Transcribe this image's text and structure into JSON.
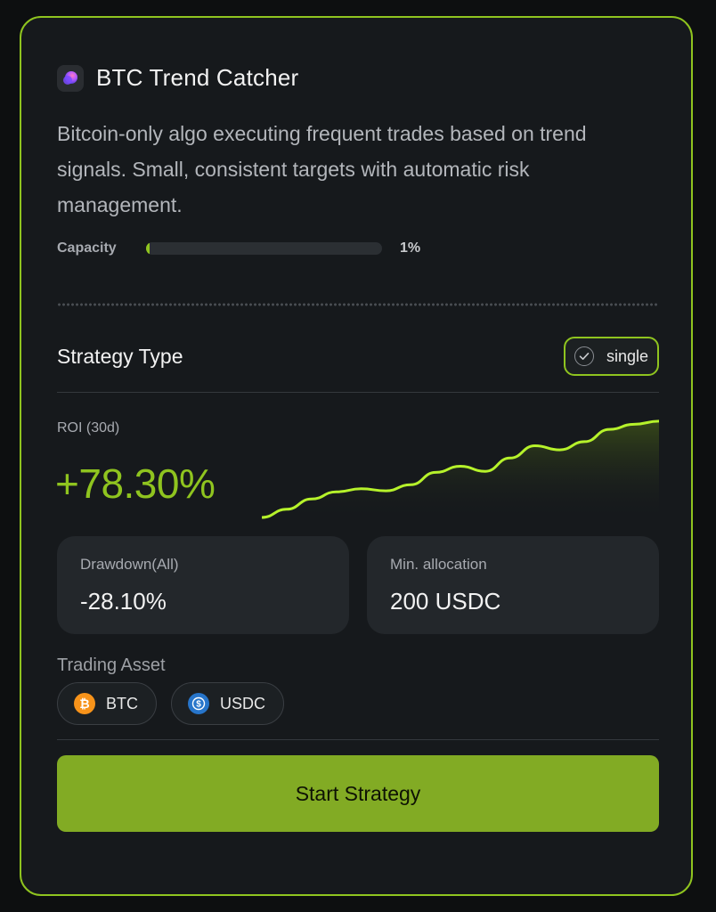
{
  "strategy": {
    "title": "BTC Trend Catcher",
    "logo_icon": "gradient-orb-icon",
    "description": "Bitcoin-only algo executing frequent trades based on trend signals. Small, consistent targets with automatic risk management.",
    "capacity_label": "Capacity",
    "capacity_percent": 1,
    "capacity_text": "1%"
  },
  "strategy_type": {
    "label": "Strategy Type",
    "badge_label": "single",
    "badge_icon": "check-circle-icon"
  },
  "roi": {
    "label": "ROI (30d)",
    "value": "+78.30%"
  },
  "stats": {
    "drawdown_label": "Drawdown(All)",
    "drawdown_value": "-28.10%",
    "min_alloc_label": "Min. allocation",
    "min_alloc_value": "200 USDC"
  },
  "assets": {
    "label": "Trading Asset",
    "items": [
      {
        "name": "BTC",
        "icon": "bitcoin-icon",
        "color": "#f7931a"
      },
      {
        "name": "USDC",
        "icon": "usdc-icon",
        "color": "#2775ca"
      }
    ]
  },
  "actions": {
    "start_label": "Start Strategy"
  },
  "colors": {
    "accent": "#8fc41f",
    "button": "#82ab24",
    "card_bg": "#16191c"
  },
  "chart_data": {
    "type": "area",
    "x": [
      0,
      1,
      2,
      3,
      4,
      5,
      6,
      7,
      8,
      9,
      10,
      11,
      12,
      13,
      14,
      15,
      16
    ],
    "values": [
      0,
      8,
      18,
      25,
      28,
      26,
      32,
      44,
      50,
      45,
      58,
      70,
      66,
      74,
      86,
      91,
      94
    ],
    "ylim": [
      0,
      100
    ],
    "title": "",
    "xlabel": "",
    "ylabel": "",
    "grid": false
  }
}
